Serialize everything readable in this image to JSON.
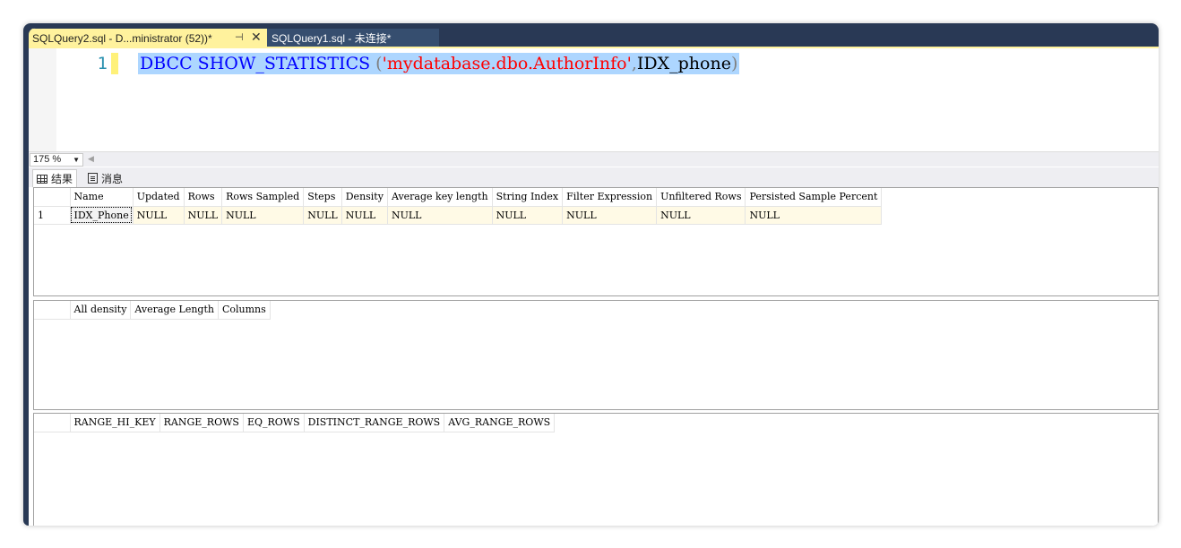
{
  "tabs": {
    "active_label": "SQLQuery2.sql - D...ministrator (52))*",
    "inactive_label": "SQLQuery1.sql - 未连接*",
    "pin_glyph": "⊣",
    "close_glyph": "✕"
  },
  "editor": {
    "line_number": "1",
    "code": {
      "kw1": "DBCC",
      "kw2": "SHOW_STATISTICS",
      "paren_open": "(",
      "string": "'mydatabase.dbo.AuthorInfo'",
      "comma": ",",
      "ident": "IDX_phone",
      "paren_close": ")"
    }
  },
  "zoom": {
    "value": "175 %"
  },
  "result_tabs": {
    "results": "结果",
    "messages": "消息"
  },
  "grid1": {
    "headers": [
      "Name",
      "Updated",
      "Rows",
      "Rows Sampled",
      "Steps",
      "Density",
      "Average key length",
      "String Index",
      "Filter Expression",
      "Unfiltered Rows",
      "Persisted Sample Percent"
    ],
    "rows": [
      {
        "num": "1",
        "cells": [
          "IDX_Phone",
          "NULL",
          "NULL",
          "NULL",
          "NULL",
          "NULL",
          "NULL",
          "NULL",
          "NULL",
          "NULL",
          "NULL"
        ]
      }
    ]
  },
  "grid2": {
    "headers": [
      "All density",
      "Average Length",
      "Columns"
    ]
  },
  "grid3": {
    "headers": [
      "RANGE_HI_KEY",
      "RANGE_ROWS",
      "EQ_ROWS",
      "DISTINCT_RANGE_ROWS",
      "AVG_RANGE_ROWS"
    ]
  }
}
